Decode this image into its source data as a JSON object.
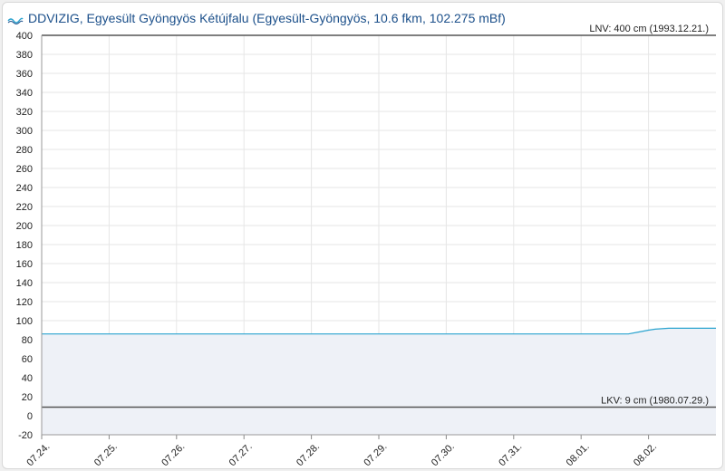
{
  "header": {
    "logo_icon": "ddvizig-logo-icon",
    "title": "DDVIZIG, Egyesült Gyöngyös Kétújfalu (Egyesült-Gyöngyös, 10.6 fkm, 102.275 mBf)"
  },
  "chart_data": {
    "type": "area",
    "title": "DDVIZIG, Egyesült Gyöngyös Kétújfalu (Egyesült-Gyöngyös, 10.6 fkm, 102.275 mBf)",
    "xlabel": "",
    "ylabel": "",
    "ylim": [
      -20,
      400
    ],
    "xlim": [
      0,
      10
    ],
    "y_ticks": [
      400,
      380,
      360,
      340,
      320,
      300,
      280,
      260,
      240,
      220,
      200,
      180,
      160,
      140,
      120,
      100,
      80,
      60,
      40,
      20,
      0,
      -20
    ],
    "x_ticks": [
      {
        "pos": 0,
        "label": "07.24."
      },
      {
        "pos": 1,
        "label": "07.25."
      },
      {
        "pos": 2,
        "label": "07.26."
      },
      {
        "pos": 3,
        "label": "07.27."
      },
      {
        "pos": 4,
        "label": "07.28."
      },
      {
        "pos": 5,
        "label": "07.29."
      },
      {
        "pos": 6,
        "label": "07.30."
      },
      {
        "pos": 7,
        "label": "07.31."
      },
      {
        "pos": 8,
        "label": "08.01."
      },
      {
        "pos": 9,
        "label": "08.02."
      }
    ],
    "grid": true,
    "series": [
      {
        "x": [
          0,
          1,
          2,
          3,
          4,
          5,
          6,
          7,
          8,
          8.7,
          8.85,
          9.0,
          9.1,
          9.3,
          9.5,
          10
        ],
        "values": [
          86,
          86,
          86,
          86,
          86,
          86,
          86,
          86,
          86,
          86,
          88,
          90,
          91,
          92,
          92,
          92
        ]
      }
    ],
    "reference_lines": [
      {
        "label": "LNV: 400 cm (1993.12.21.)",
        "value": 400
      },
      {
        "label": "LKV: 9 cm (1980.07.29.)",
        "value": 9
      }
    ],
    "colors": {
      "line": "#2aa3cf",
      "area_fill": "#eef1f7",
      "grid": "#e6e6e6",
      "reference": "#555555"
    }
  }
}
